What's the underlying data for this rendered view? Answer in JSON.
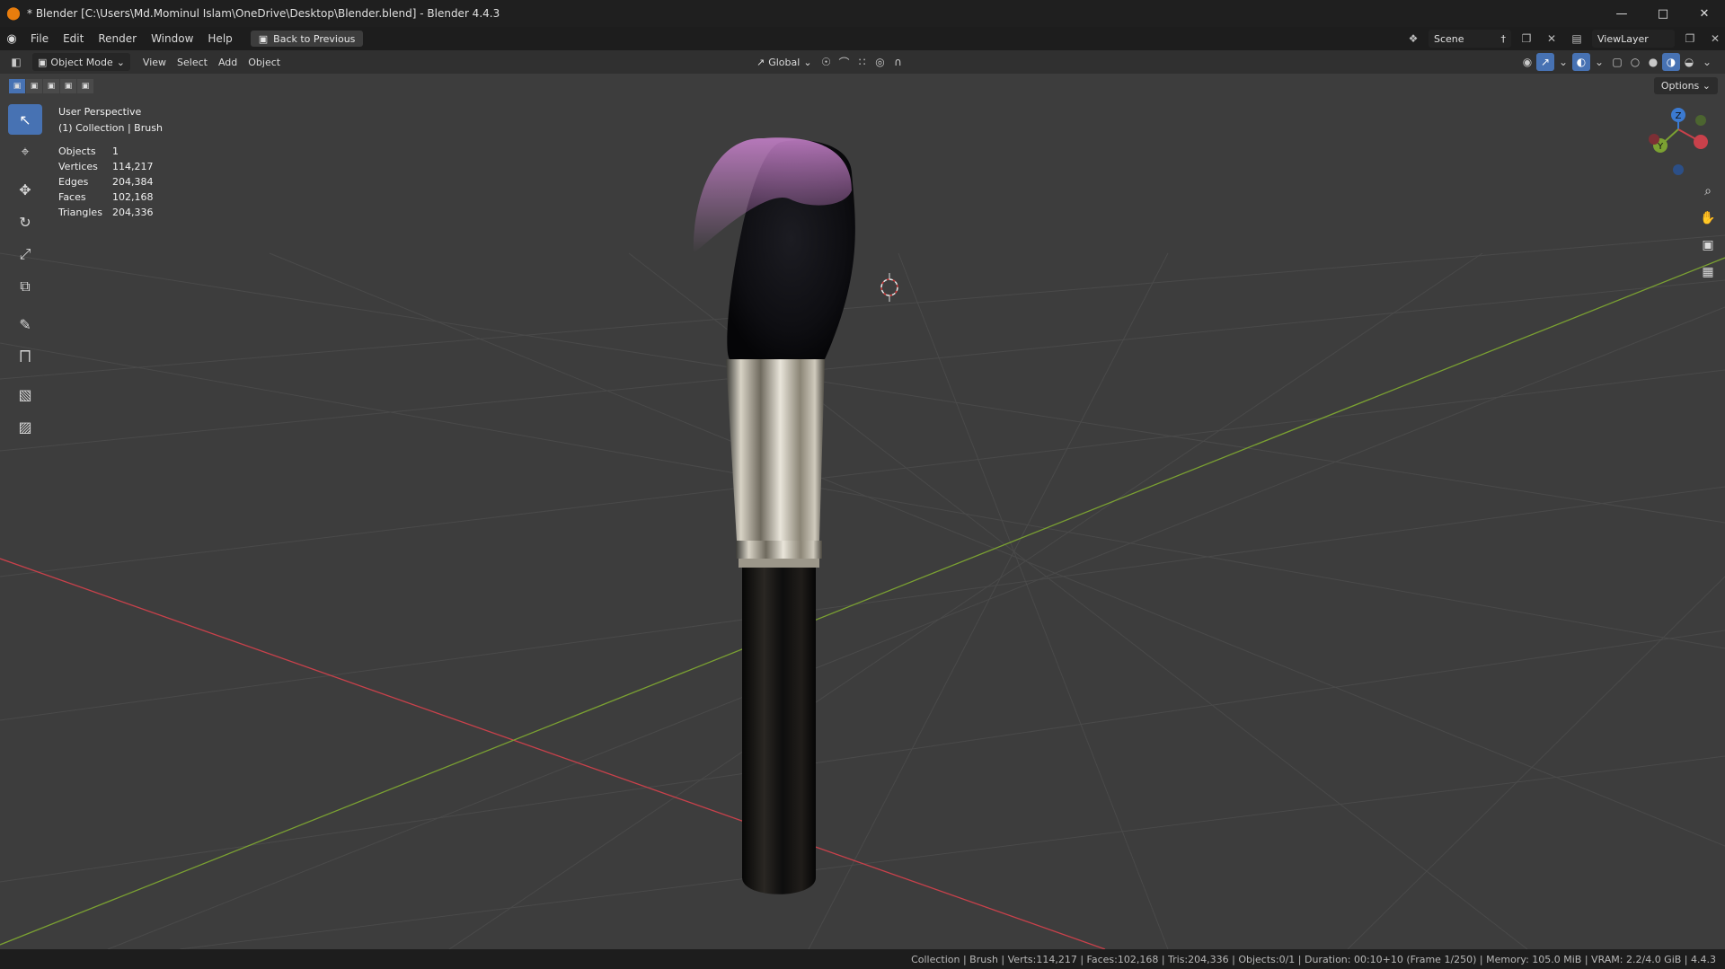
{
  "window": {
    "title": "* Blender [C:\\Users\\Md.Mominul Islam\\OneDrive\\Desktop\\Blender.blend] - Blender 4.4.3",
    "app_icon": "blender-icon",
    "controls": [
      "minimize-icon",
      "maximize-icon",
      "close-icon"
    ]
  },
  "menubar": {
    "items": [
      "File",
      "Edit",
      "Render",
      "Window",
      "Help"
    ],
    "back_button": "Back to Previous",
    "scene_name": "Scene",
    "view_layer": "ViewLayer"
  },
  "header": {
    "mode": "Object Mode",
    "menus": [
      "View",
      "Select",
      "Add",
      "Object"
    ],
    "orientation": "Global"
  },
  "viewport": {
    "perspective_label": "User Perspective",
    "collection_label": "(1) Collection | Brush",
    "stats": [
      {
        "label": "Objects",
        "value": "1"
      },
      {
        "label": "Vertices",
        "value": "114,217"
      },
      {
        "label": "Edges",
        "value": "204,384"
      },
      {
        "label": "Faces",
        "value": "102,168"
      },
      {
        "label": "Triangles",
        "value": "204,336"
      }
    ],
    "options_label": "Options",
    "gizmo_axes": [
      "Z",
      "Y",
      "X"
    ],
    "colors": {
      "background": "#3d3d3d",
      "x_axis": "#c9414b",
      "y_axis": "#7ba132",
      "bristle_tip": "#c47fc8",
      "active_tool": "#4772b3"
    }
  },
  "statusbar": {
    "text": "Collection | Brush | Verts:114,217 | Faces:102,168 | Tris:204,336 | Objects:0/1 | Duration: 00:10+10 (Frame 1/250) | Memory: 105.0 MiB | VRAM: 2.2/4.0 GiB | 4.4.3"
  }
}
